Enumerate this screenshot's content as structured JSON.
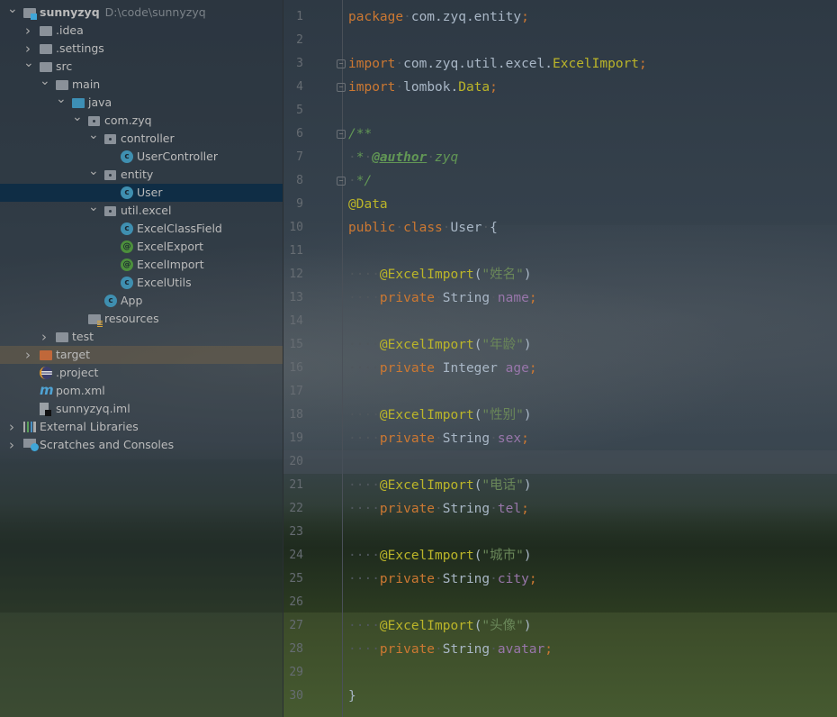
{
  "project": {
    "tree": [
      {
        "depth": 0,
        "chev": "down",
        "icon": "module",
        "label": "sunnyzyq",
        "path": "D:\\code\\sunnyzyq",
        "bold": true
      },
      {
        "depth": 1,
        "chev": "right",
        "icon": "folder",
        "label": ".idea"
      },
      {
        "depth": 1,
        "chev": "right",
        "icon": "folder",
        "label": ".settings"
      },
      {
        "depth": 1,
        "chev": "down",
        "icon": "folder",
        "label": "src"
      },
      {
        "depth": 2,
        "chev": "down",
        "icon": "folder",
        "label": "main"
      },
      {
        "depth": 3,
        "chev": "down",
        "icon": "folder-blue",
        "label": "java"
      },
      {
        "depth": 4,
        "chev": "down",
        "icon": "package",
        "label": "com.zyq"
      },
      {
        "depth": 5,
        "chev": "down",
        "icon": "package",
        "label": "controller"
      },
      {
        "depth": 6,
        "icon": "class",
        "label": "UserController"
      },
      {
        "depth": 5,
        "chev": "down",
        "icon": "package",
        "label": "entity"
      },
      {
        "depth": 6,
        "icon": "class",
        "label": "User",
        "selected": true
      },
      {
        "depth": 5,
        "chev": "down",
        "icon": "package",
        "label": "util.excel"
      },
      {
        "depth": 6,
        "icon": "class",
        "label": "ExcelClassField"
      },
      {
        "depth": 6,
        "icon": "annotation",
        "label": "ExcelExport"
      },
      {
        "depth": 6,
        "icon": "annotation",
        "label": "ExcelImport"
      },
      {
        "depth": 6,
        "icon": "class",
        "label": "ExcelUtils"
      },
      {
        "depth": 5,
        "icon": "class",
        "label": "App"
      },
      {
        "depth": 4,
        "icon": "resources",
        "label": "resources"
      },
      {
        "depth": 2,
        "chev": "right",
        "icon": "folder",
        "label": "test"
      },
      {
        "depth": 1,
        "chev": "right",
        "icon": "folder-orange",
        "label": "target",
        "highlight": true
      },
      {
        "depth": 1,
        "icon": "eclipse",
        "label": ".project"
      },
      {
        "depth": 1,
        "icon": "maven",
        "label": "pom.xml"
      },
      {
        "depth": 1,
        "icon": "file",
        "label": "sunnyzyq.iml"
      },
      {
        "depth": 0,
        "chev": "right",
        "icon": "libraries",
        "label": "External Libraries"
      },
      {
        "depth": 0,
        "chev": "right",
        "icon": "scratches",
        "label": "Scratches and Consoles"
      }
    ]
  },
  "editor": {
    "current_line": 20,
    "lines": [
      [
        [
          "kw",
          "package"
        ],
        [
          "ws",
          "·"
        ],
        [
          "txt",
          "com.zyq.entity"
        ],
        [
          "kw",
          ";"
        ]
      ],
      [],
      [
        [
          "kw",
          "import"
        ],
        [
          "ws",
          "·"
        ],
        [
          "txt",
          "com.zyq.util.excel."
        ],
        [
          "ann",
          "ExcelImport"
        ],
        [
          "kw",
          ";"
        ]
      ],
      [
        [
          "kw",
          "import"
        ],
        [
          "ws",
          "·"
        ],
        [
          "txt",
          "lombok."
        ],
        [
          "ann",
          "Data"
        ],
        [
          "kw",
          ";"
        ]
      ],
      [],
      [
        [
          "cm",
          "/**"
        ]
      ],
      [
        [
          "ws",
          "·"
        ],
        [
          "cm",
          "*"
        ],
        [
          "ws",
          "·"
        ],
        [
          "tag",
          "@author"
        ],
        [
          "ws",
          "·"
        ],
        [
          "cm",
          "zyq"
        ]
      ],
      [
        [
          "ws",
          "·"
        ],
        [
          "cm",
          "*/"
        ]
      ],
      [
        [
          "ann",
          "@Data"
        ]
      ],
      [
        [
          "kw",
          "public"
        ],
        [
          "ws",
          "·"
        ],
        [
          "kw",
          "class"
        ],
        [
          "ws",
          "·"
        ],
        [
          "txt",
          "User"
        ],
        [
          "ws",
          "·"
        ],
        [
          "txt",
          "{"
        ]
      ],
      [],
      [
        [
          "ws",
          "····"
        ],
        [
          "ann",
          "@ExcelImport"
        ],
        [
          "txt",
          "("
        ],
        [
          "str",
          "\"姓名\""
        ],
        [
          "txt",
          ")"
        ]
      ],
      [
        [
          "ws",
          "····"
        ],
        [
          "kw",
          "private"
        ],
        [
          "ws",
          "·"
        ],
        [
          "txt",
          "String"
        ],
        [
          "ws",
          "·"
        ],
        [
          "fld",
          "name"
        ],
        [
          "kw",
          ";"
        ]
      ],
      [],
      [
        [
          "ws",
          "····"
        ],
        [
          "ann",
          "@ExcelImport"
        ],
        [
          "txt",
          "("
        ],
        [
          "str",
          "\"年龄\""
        ],
        [
          "txt",
          ")"
        ]
      ],
      [
        [
          "ws",
          "····"
        ],
        [
          "kw",
          "private"
        ],
        [
          "ws",
          "·"
        ],
        [
          "txt",
          "Integer"
        ],
        [
          "ws",
          "·"
        ],
        [
          "fld",
          "age"
        ],
        [
          "kw",
          ";"
        ]
      ],
      [],
      [
        [
          "ws",
          "····"
        ],
        [
          "ann",
          "@ExcelImport"
        ],
        [
          "txt",
          "("
        ],
        [
          "str",
          "\"性别\""
        ],
        [
          "txt",
          ")"
        ]
      ],
      [
        [
          "ws",
          "····"
        ],
        [
          "kw",
          "private"
        ],
        [
          "ws",
          "·"
        ],
        [
          "txt",
          "String"
        ],
        [
          "ws",
          "·"
        ],
        [
          "fld",
          "sex"
        ],
        [
          "kw",
          ";"
        ]
      ],
      [],
      [
        [
          "ws",
          "····"
        ],
        [
          "ann",
          "@ExcelImport"
        ],
        [
          "txt",
          "("
        ],
        [
          "str",
          "\"电话\""
        ],
        [
          "txt",
          ")"
        ]
      ],
      [
        [
          "ws",
          "····"
        ],
        [
          "kw",
          "private"
        ],
        [
          "ws",
          "·"
        ],
        [
          "txt",
          "String"
        ],
        [
          "ws",
          "·"
        ],
        [
          "fld",
          "tel"
        ],
        [
          "kw",
          ";"
        ]
      ],
      [],
      [
        [
          "ws",
          "····"
        ],
        [
          "ann",
          "@ExcelImport"
        ],
        [
          "txt",
          "("
        ],
        [
          "str",
          "\"城市\""
        ],
        [
          "txt",
          ")"
        ]
      ],
      [
        [
          "ws",
          "····"
        ],
        [
          "kw",
          "private"
        ],
        [
          "ws",
          "·"
        ],
        [
          "txt",
          "String"
        ],
        [
          "ws",
          "·"
        ],
        [
          "fld",
          "city"
        ],
        [
          "kw",
          ";"
        ]
      ],
      [],
      [
        [
          "ws",
          "····"
        ],
        [
          "ann",
          "@ExcelImport"
        ],
        [
          "txt",
          "("
        ],
        [
          "str",
          "\"头像\""
        ],
        [
          "txt",
          ")"
        ]
      ],
      [
        [
          "ws",
          "····"
        ],
        [
          "kw",
          "private"
        ],
        [
          "ws",
          "·"
        ],
        [
          "txt",
          "String"
        ],
        [
          "ws",
          "·"
        ],
        [
          "fld",
          "avatar"
        ],
        [
          "kw",
          ";"
        ]
      ],
      [],
      [
        [
          "txt",
          "}"
        ]
      ]
    ],
    "folds": [
      3,
      4,
      6,
      8
    ]
  }
}
